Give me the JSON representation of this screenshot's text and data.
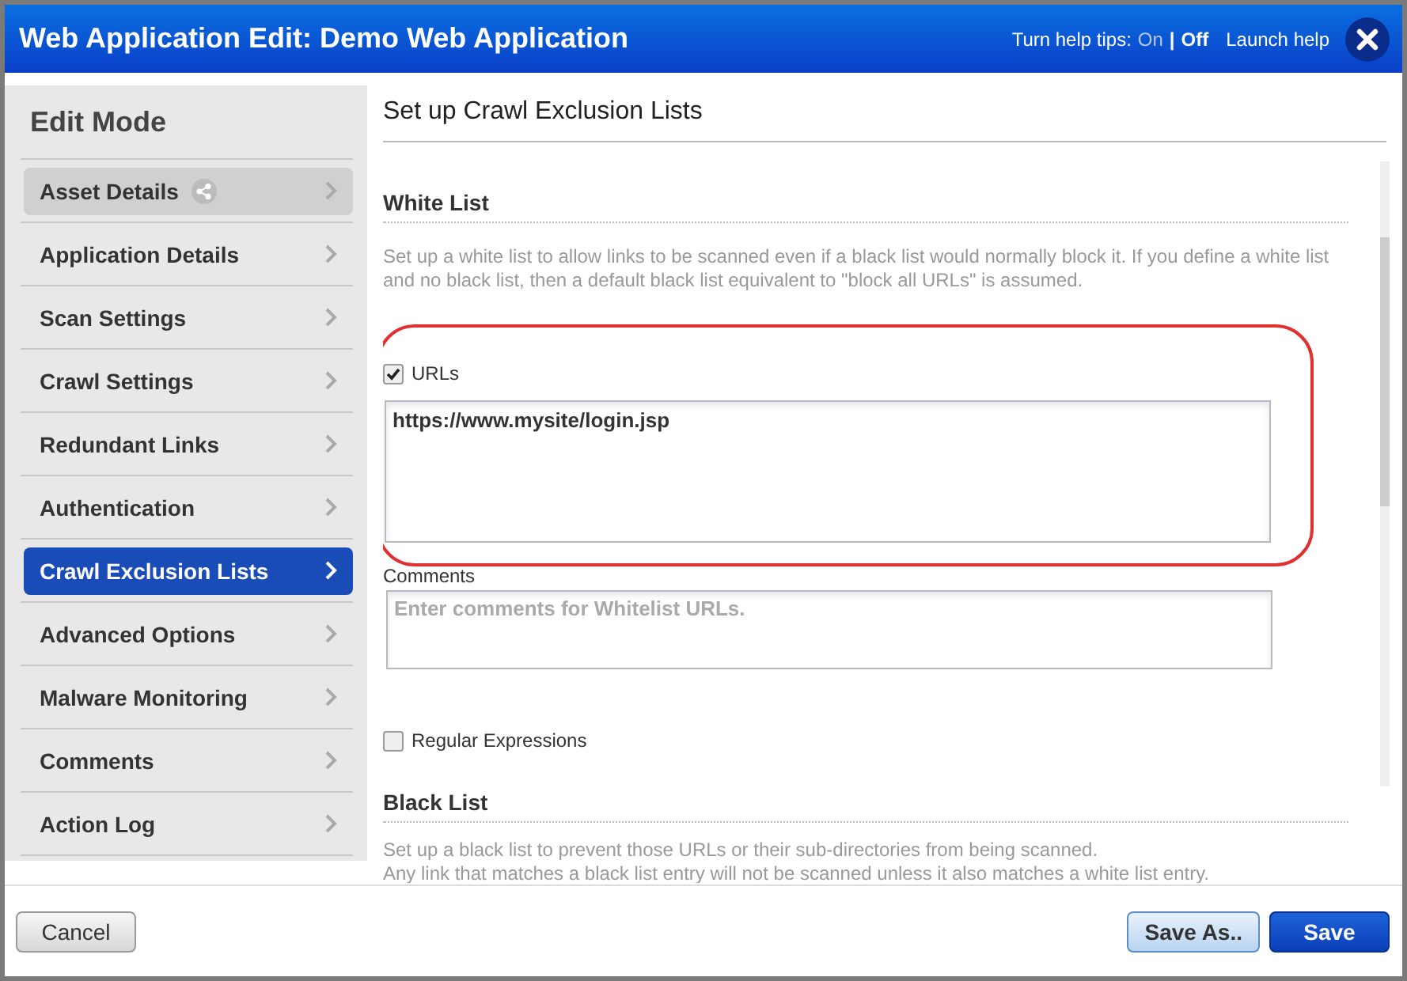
{
  "window": {
    "title": "Web Application Edit: Demo Web Application"
  },
  "help_tips": {
    "label": "Turn help tips:",
    "options": [
      {
        "label": "On",
        "selected": false
      },
      {
        "label": "Off",
        "selected": true
      }
    ],
    "separator": "|"
  },
  "launch_help": "Launch help",
  "sidebar": {
    "title": "Edit Mode",
    "items": [
      {
        "label": "Asset Details",
        "selected": false,
        "highlighted": true,
        "shared": true
      },
      {
        "label": "Application Details",
        "selected": false,
        "highlighted": false,
        "shared": false
      },
      {
        "label": "Scan Settings",
        "selected": false,
        "highlighted": false,
        "shared": false
      },
      {
        "label": "Crawl Settings",
        "selected": false,
        "highlighted": false,
        "shared": false
      },
      {
        "label": "Redundant Links",
        "selected": false,
        "highlighted": false,
        "shared": false
      },
      {
        "label": "Authentication",
        "selected": false,
        "highlighted": false,
        "shared": false
      },
      {
        "label": "Crawl Exclusion Lists",
        "selected": true,
        "highlighted": false,
        "shared": false
      },
      {
        "label": "Advanced Options",
        "selected": false,
        "highlighted": false,
        "shared": false
      },
      {
        "label": "Malware Monitoring",
        "selected": false,
        "highlighted": false,
        "shared": false
      },
      {
        "label": "Comments",
        "selected": false,
        "highlighted": false,
        "shared": false
      },
      {
        "label": "Action Log",
        "selected": false,
        "highlighted": false,
        "shared": false
      }
    ]
  },
  "panel": {
    "title": "Set up Crawl Exclusion Lists",
    "white_list": {
      "heading": "White List",
      "description": "Set up a white list to allow links to be scanned even if a black list would normally block it. If you define a white list and no black list, then a default black list equivalent to \"block all URLs\" is assumed.",
      "urls": {
        "label": "URLs",
        "checked": true,
        "value": "https://www.mysite/login.jsp"
      },
      "comments": {
        "label": "Comments",
        "placeholder": "Enter comments for Whitelist URLs."
      },
      "regex": {
        "label": "Regular Expressions",
        "checked": false
      }
    },
    "black_list": {
      "heading": "Black List",
      "description": [
        "Set up a black list to prevent those URLs or their sub-directories from being scanned.",
        "Any link that matches a black list entry will not be scanned unless it also matches a white list entry."
      ]
    }
  },
  "buttons": [
    {
      "label": "Cancel",
      "kind": "plain"
    },
    {
      "label": "Save As..",
      "kind": "secondary"
    },
    {
      "label": "Save",
      "kind": "primary"
    }
  ]
}
